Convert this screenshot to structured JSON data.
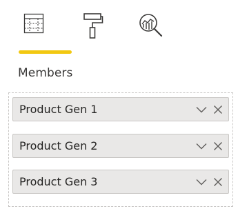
{
  "tabs": [
    {
      "icon": "fields-icon",
      "selected": true
    },
    {
      "icon": "paint-roller-icon",
      "selected": false
    },
    {
      "icon": "analytics-icon",
      "selected": false
    }
  ],
  "accent_color": "#F2C811",
  "well": {
    "label": "Members",
    "items": [
      {
        "label": "Product Gen 1",
        "actions": [
          "chevron-down-icon",
          "close-icon"
        ]
      },
      {
        "label": "Product Gen 2",
        "actions": [
          "chevron-down-icon",
          "close-icon"
        ]
      },
      {
        "label": "Product Gen 3",
        "actions": [
          "chevron-down-icon",
          "close-icon"
        ]
      }
    ]
  }
}
